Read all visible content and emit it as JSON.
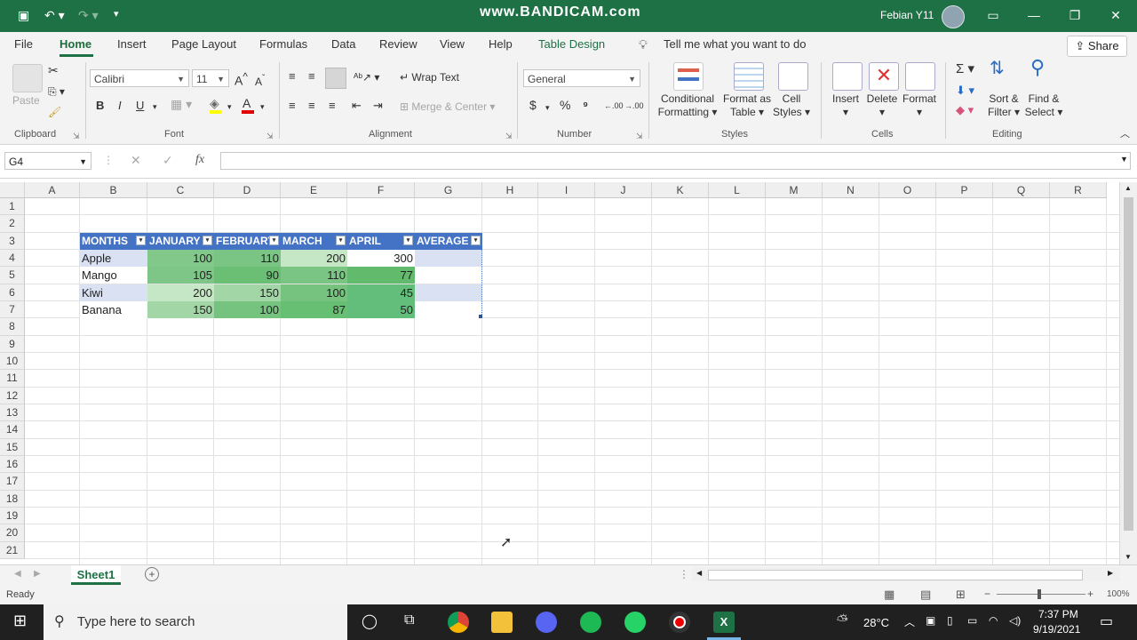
{
  "watermark": "www.BANDICAM.com",
  "user": "Febian Y11",
  "colors": {
    "excel_green": "#1e7145",
    "table_header": "#4472c4",
    "band_light": "#d9e1f2"
  },
  "menu": {
    "file": "File",
    "home": "Home",
    "insert": "Insert",
    "page_layout": "Page Layout",
    "formulas": "Formulas",
    "data": "Data",
    "review": "Review",
    "view": "View",
    "help": "Help",
    "table_design": "Table Design",
    "tell_me": "Tell me what you want to do",
    "share": "Share"
  },
  "ribbon": {
    "paste": "Paste",
    "clipboard": "Clipboard",
    "font_name": "Calibri",
    "font_size": "11",
    "font": "Font",
    "bold": "B",
    "italic": "I",
    "underline": "U",
    "wrap_text": "Wrap Text",
    "merge_center": "Merge & Center",
    "alignment": "Alignment",
    "number_format": "General",
    "number": "Number",
    "dollar": "$",
    "percent": "%",
    "comma": "⁹",
    "dec_inc": ".00",
    "dec_dec": ".00",
    "cond_format_1": "Conditional",
    "cond_format_2": "Formatting",
    "format_table_1": "Format as",
    "format_table_2": "Table",
    "cell_styles_1": "Cell",
    "cell_styles_2": "Styles",
    "styles": "Styles",
    "insert": "Insert",
    "delete": "Delete",
    "format": "Format",
    "cells": "Cells",
    "sort_1": "Sort &",
    "sort_2": "Filter",
    "find_1": "Find &",
    "find_2": "Select",
    "editing": "Editing"
  },
  "formula_bar": {
    "name_box": "G4",
    "fx": "fx",
    "content": ""
  },
  "columns": [
    "A",
    "B",
    "C",
    "D",
    "E",
    "F",
    "G",
    "H",
    "I",
    "J",
    "K",
    "L",
    "M",
    "N",
    "O",
    "P",
    "Q",
    "R"
  ],
  "rows": [
    "1",
    "2",
    "3",
    "4",
    "5",
    "6",
    "7",
    "8",
    "9",
    "10",
    "11",
    "12",
    "13",
    "14",
    "15",
    "16",
    "17",
    "18",
    "19",
    "20",
    "21"
  ],
  "table": {
    "headers": [
      "MONTHS",
      "JANUARY",
      "FEBRUARY",
      "MARCH",
      "APRIL",
      "AVERAGE"
    ],
    "rows": [
      {
        "name": "Apple",
        "values": [
          "100",
          "110",
          "200",
          "300"
        ],
        "shades": [
          "#82c88a",
          "#7ac583",
          "#c6e7c6",
          "#ffffff"
        ]
      },
      {
        "name": "Mango",
        "values": [
          "105",
          "90",
          "110",
          "77"
        ],
        "shades": [
          "#7ec687",
          "#6bbf75",
          "#7ac583",
          "#62bb6d"
        ]
      },
      {
        "name": "Kiwi",
        "values": [
          "200",
          "150",
          "100",
          "45"
        ],
        "shades": [
          "#c6e7c6",
          "#a2d6a7",
          "#75c37e",
          "#63be7b"
        ]
      },
      {
        "name": "Banana",
        "values": [
          "150",
          "100",
          "87",
          "50"
        ],
        "shades": [
          "#a2d6a7",
          "#75c37e",
          "#66bf72",
          "#63be7b"
        ]
      }
    ]
  },
  "sheet": {
    "tab": "Sheet1",
    "status": "Ready",
    "zoom": "100%"
  },
  "taskbar": {
    "search": "Type here to search",
    "weather": "28°C",
    "time": "7:37 PM",
    "date": "9/19/2021"
  }
}
